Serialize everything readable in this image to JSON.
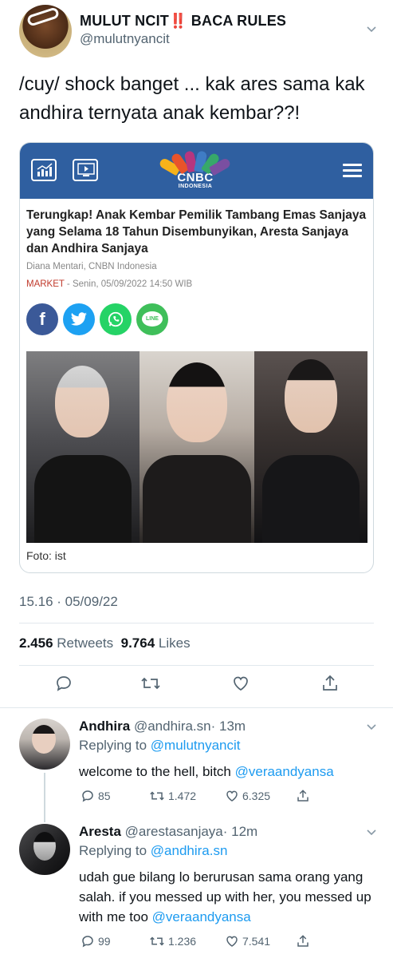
{
  "tweet": {
    "display_name": "MULUT NCIT‼️ BACA RULES",
    "handle": "@mulutnyancit",
    "text": "/cuy/ shock banget ... kak ares sama kak andhira ternyata anak kembar??!",
    "timestamp": "15.16 · 05/09/22",
    "retweets_count": "2.456",
    "retweets_label": "Retweets",
    "likes_count": "9.764",
    "likes_label": "Likes"
  },
  "card": {
    "logo_text": "CNBC",
    "logo_sub": "INDONESIA",
    "headline": "Terungkap! Anak Kembar Pemilik Tambang Emas Sanjaya yang Selama 18 Tahun Disembunyikan, Aresta Sanjaya dan Andhira Sanjaya",
    "byline": "Diana Mentari, CNBN Indonesia",
    "category": "MARKET",
    "date": " - Senin, 05/09/2022 14:50 WIB",
    "line_label": "LINE",
    "caption": "Foto: ist"
  },
  "replies": [
    {
      "name": "Andhira",
      "handle": "@andhira.sn",
      "time": "· 13m",
      "replying_to_label": "Replying to",
      "replying_to": "@mulutnyancit",
      "text": "welcome to the hell, bitch ",
      "mention": "@veraandyansa",
      "replies": "85",
      "retweets": "1.472",
      "likes": "6.325"
    },
    {
      "name": "Aresta",
      "handle": "@arestasanjaya",
      "time": "· 12m",
      "replying_to_label": "Replying to",
      "replying_to": "@andhira.sn",
      "text": "udah gue bilang lo berurusan sama orang yang salah. if you messed up with her, you messed up with me too ",
      "mention": "@veraandyansa",
      "replies": "99",
      "retweets": "1.236",
      "likes": "7.541"
    }
  ],
  "icons": {
    "reply": "reply-icon",
    "retweet": "retweet-icon",
    "like": "heart-icon",
    "share": "share-icon",
    "more": "chevron-down-icon"
  },
  "colors": {
    "link": "#1d9bf0",
    "cnbc_blue": "#2f5fa0",
    "market_red": "#c0392b"
  }
}
